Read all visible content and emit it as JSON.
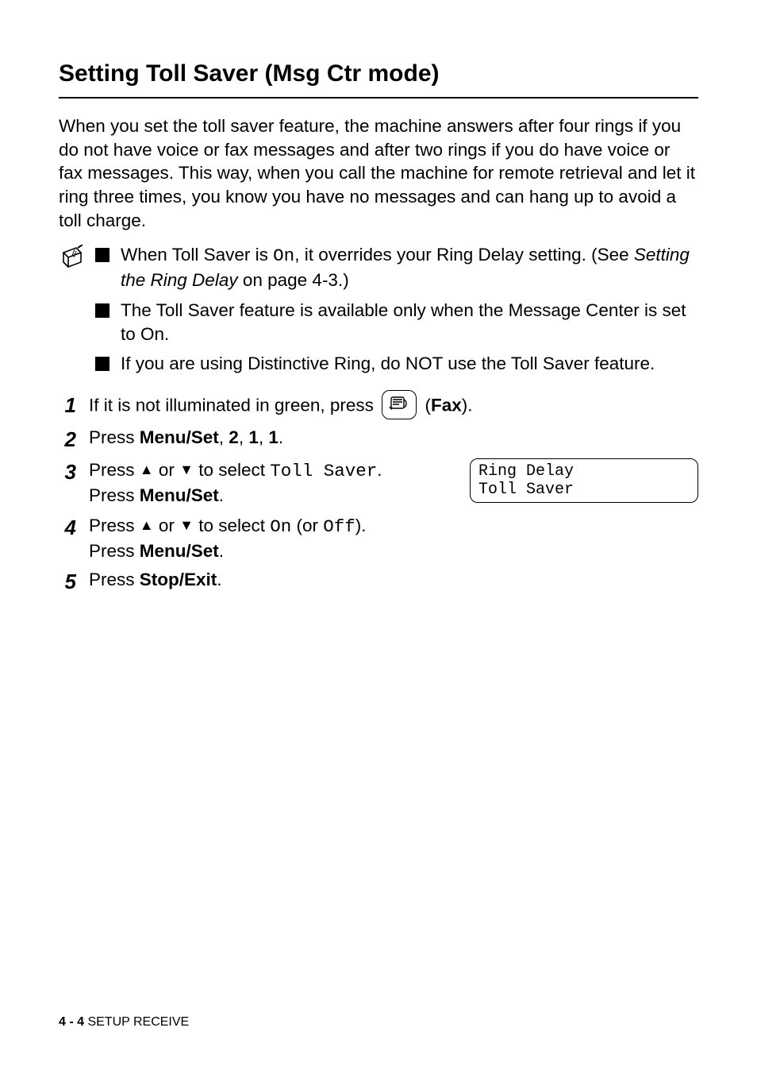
{
  "title": "Setting Toll Saver (Msg Ctr mode)",
  "intro": "When you set the toll saver feature, the machine answers after four rings if you do not have voice or fax messages and after two rings if you do have voice or fax messages. This way, when you call the machine for remote retrieval and let it ring three times, you know you have no messages and can hang up to avoid a toll charge.",
  "notes": [
    {
      "pre": "When Toll Saver is ",
      "mono": "On",
      "mid": ", it overrides your Ring Delay setting. (See ",
      "italic": "Setting the Ring Delay",
      "post": " on page 4-3.)"
    },
    {
      "full": "The Toll Saver feature is available only when the Message Center is set to On."
    },
    {
      "full": "If you are using Distinctive Ring, do NOT use the Toll Saver feature."
    }
  ],
  "steps": {
    "s1": {
      "pre": "If it is not illuminated in green, press ",
      "post_open": " (",
      "fax_bold": "Fax",
      "post_close": ")."
    },
    "s2": {
      "pre": "Press ",
      "bold": "Menu/Set",
      "mid1": ", ",
      "b2": "2",
      "mid2": ", ",
      "b3": "1",
      "mid3": ", ",
      "b4": "1",
      "post": "."
    },
    "s3": {
      "line1_pre": "Press ",
      "arrow_up": "▲",
      "line1_mid": " or ",
      "arrow_down": "▼",
      "line1_mid2": " to select ",
      "mono": "Toll Saver",
      "line1_post": ".",
      "line2_pre": "Press ",
      "line2_bold": "Menu/Set",
      "line2_post": "."
    },
    "s4": {
      "line1_pre": "Press ",
      "arrow_up": "▲",
      "line1_mid": " or ",
      "arrow_down": "▼",
      "line1_mid2": " to select ",
      "mono1": "On",
      "line1_mid3": " (or ",
      "mono2": "Off",
      "line1_post": ").",
      "line2_pre": "Press ",
      "line2_bold": "Menu/Set",
      "line2_post": "."
    },
    "s5": {
      "pre": "Press ",
      "bold": "Stop/Exit",
      "post": "."
    }
  },
  "lcd": "Ring Delay\nToll Saver",
  "footer": {
    "page": "4 - 4",
    "section": "   SETUP RECEIVE"
  }
}
